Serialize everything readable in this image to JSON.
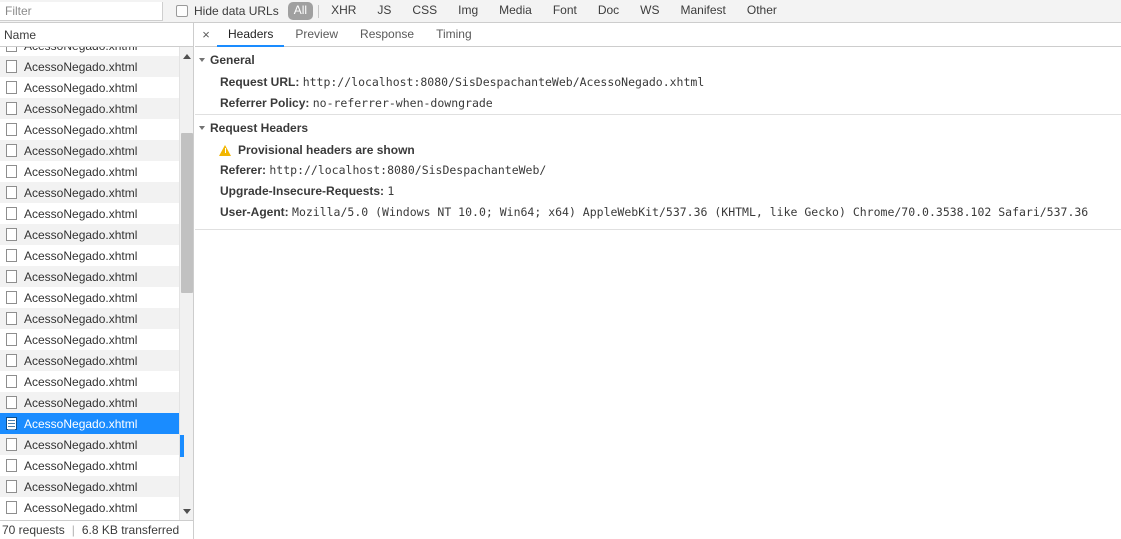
{
  "toolbar": {
    "filter_placeholder": "Filter",
    "filter_value": "",
    "hide_data_urls_label": "Hide data URLs",
    "type_filters": [
      "All",
      "XHR",
      "JS",
      "CSS",
      "Img",
      "Media",
      "Font",
      "Doc",
      "WS",
      "Manifest",
      "Other"
    ],
    "active_type_filter": "All"
  },
  "request_list": {
    "column_header": "Name",
    "selected_index": 18,
    "rows": [
      {
        "name": "AcessoNegado.xhtml"
      },
      {
        "name": "AcessoNegado.xhtml"
      },
      {
        "name": "AcessoNegado.xhtml"
      },
      {
        "name": "AcessoNegado.xhtml"
      },
      {
        "name": "AcessoNegado.xhtml"
      },
      {
        "name": "AcessoNegado.xhtml"
      },
      {
        "name": "AcessoNegado.xhtml"
      },
      {
        "name": "AcessoNegado.xhtml"
      },
      {
        "name": "AcessoNegado.xhtml"
      },
      {
        "name": "AcessoNegado.xhtml"
      },
      {
        "name": "AcessoNegado.xhtml"
      },
      {
        "name": "AcessoNegado.xhtml"
      },
      {
        "name": "AcessoNegado.xhtml"
      },
      {
        "name": "AcessoNegado.xhtml"
      },
      {
        "name": "AcessoNegado.xhtml"
      },
      {
        "name": "AcessoNegado.xhtml"
      },
      {
        "name": "AcessoNegado.xhtml"
      },
      {
        "name": "AcessoNegado.xhtml"
      },
      {
        "name": "AcessoNegado.xhtml"
      },
      {
        "name": "AcessoNegado.xhtml"
      },
      {
        "name": "AcessoNegado.xhtml"
      },
      {
        "name": "AcessoNegado.xhtml"
      },
      {
        "name": "AcessoNegado.xhtml"
      }
    ]
  },
  "status_bar": {
    "requests": "70 requests",
    "separator": "|",
    "transferred": "6.8 KB transferred"
  },
  "details": {
    "close_label": "×",
    "tabs": [
      {
        "label": "Headers",
        "active": true
      },
      {
        "label": "Preview",
        "active": false
      },
      {
        "label": "Response",
        "active": false
      },
      {
        "label": "Timing",
        "active": false
      }
    ],
    "sections": [
      {
        "title": "General",
        "warning": null,
        "entries": [
          {
            "key": "Request URL:",
            "value": "http://localhost:8080/SisDespachanteWeb/AcessoNegado.xhtml"
          },
          {
            "key": "Referrer Policy:",
            "value": "no-referrer-when-downgrade"
          }
        ]
      },
      {
        "title": "Request Headers",
        "warning": "Provisional headers are shown",
        "entries": [
          {
            "key": "Referer:",
            "value": "http://localhost:8080/SisDespachanteWeb/"
          },
          {
            "key": "Upgrade-Insecure-Requests:",
            "value": "1"
          },
          {
            "key": "User-Agent:",
            "value": "Mozilla/5.0 (Windows NT 10.0; Win64; x64) AppleWebKit/537.36 (KHTML, like Gecko) Chrome/70.0.3538.102 Safari/537.36"
          }
        ]
      }
    ]
  },
  "colors": {
    "accent_blue": "#1a8cff",
    "selected_row_bg": "#1a8cff",
    "warning_yellow": "#f2b600",
    "toolbar_bg": "#f3f3f3",
    "row_stripe": "#f2f2f2"
  }
}
